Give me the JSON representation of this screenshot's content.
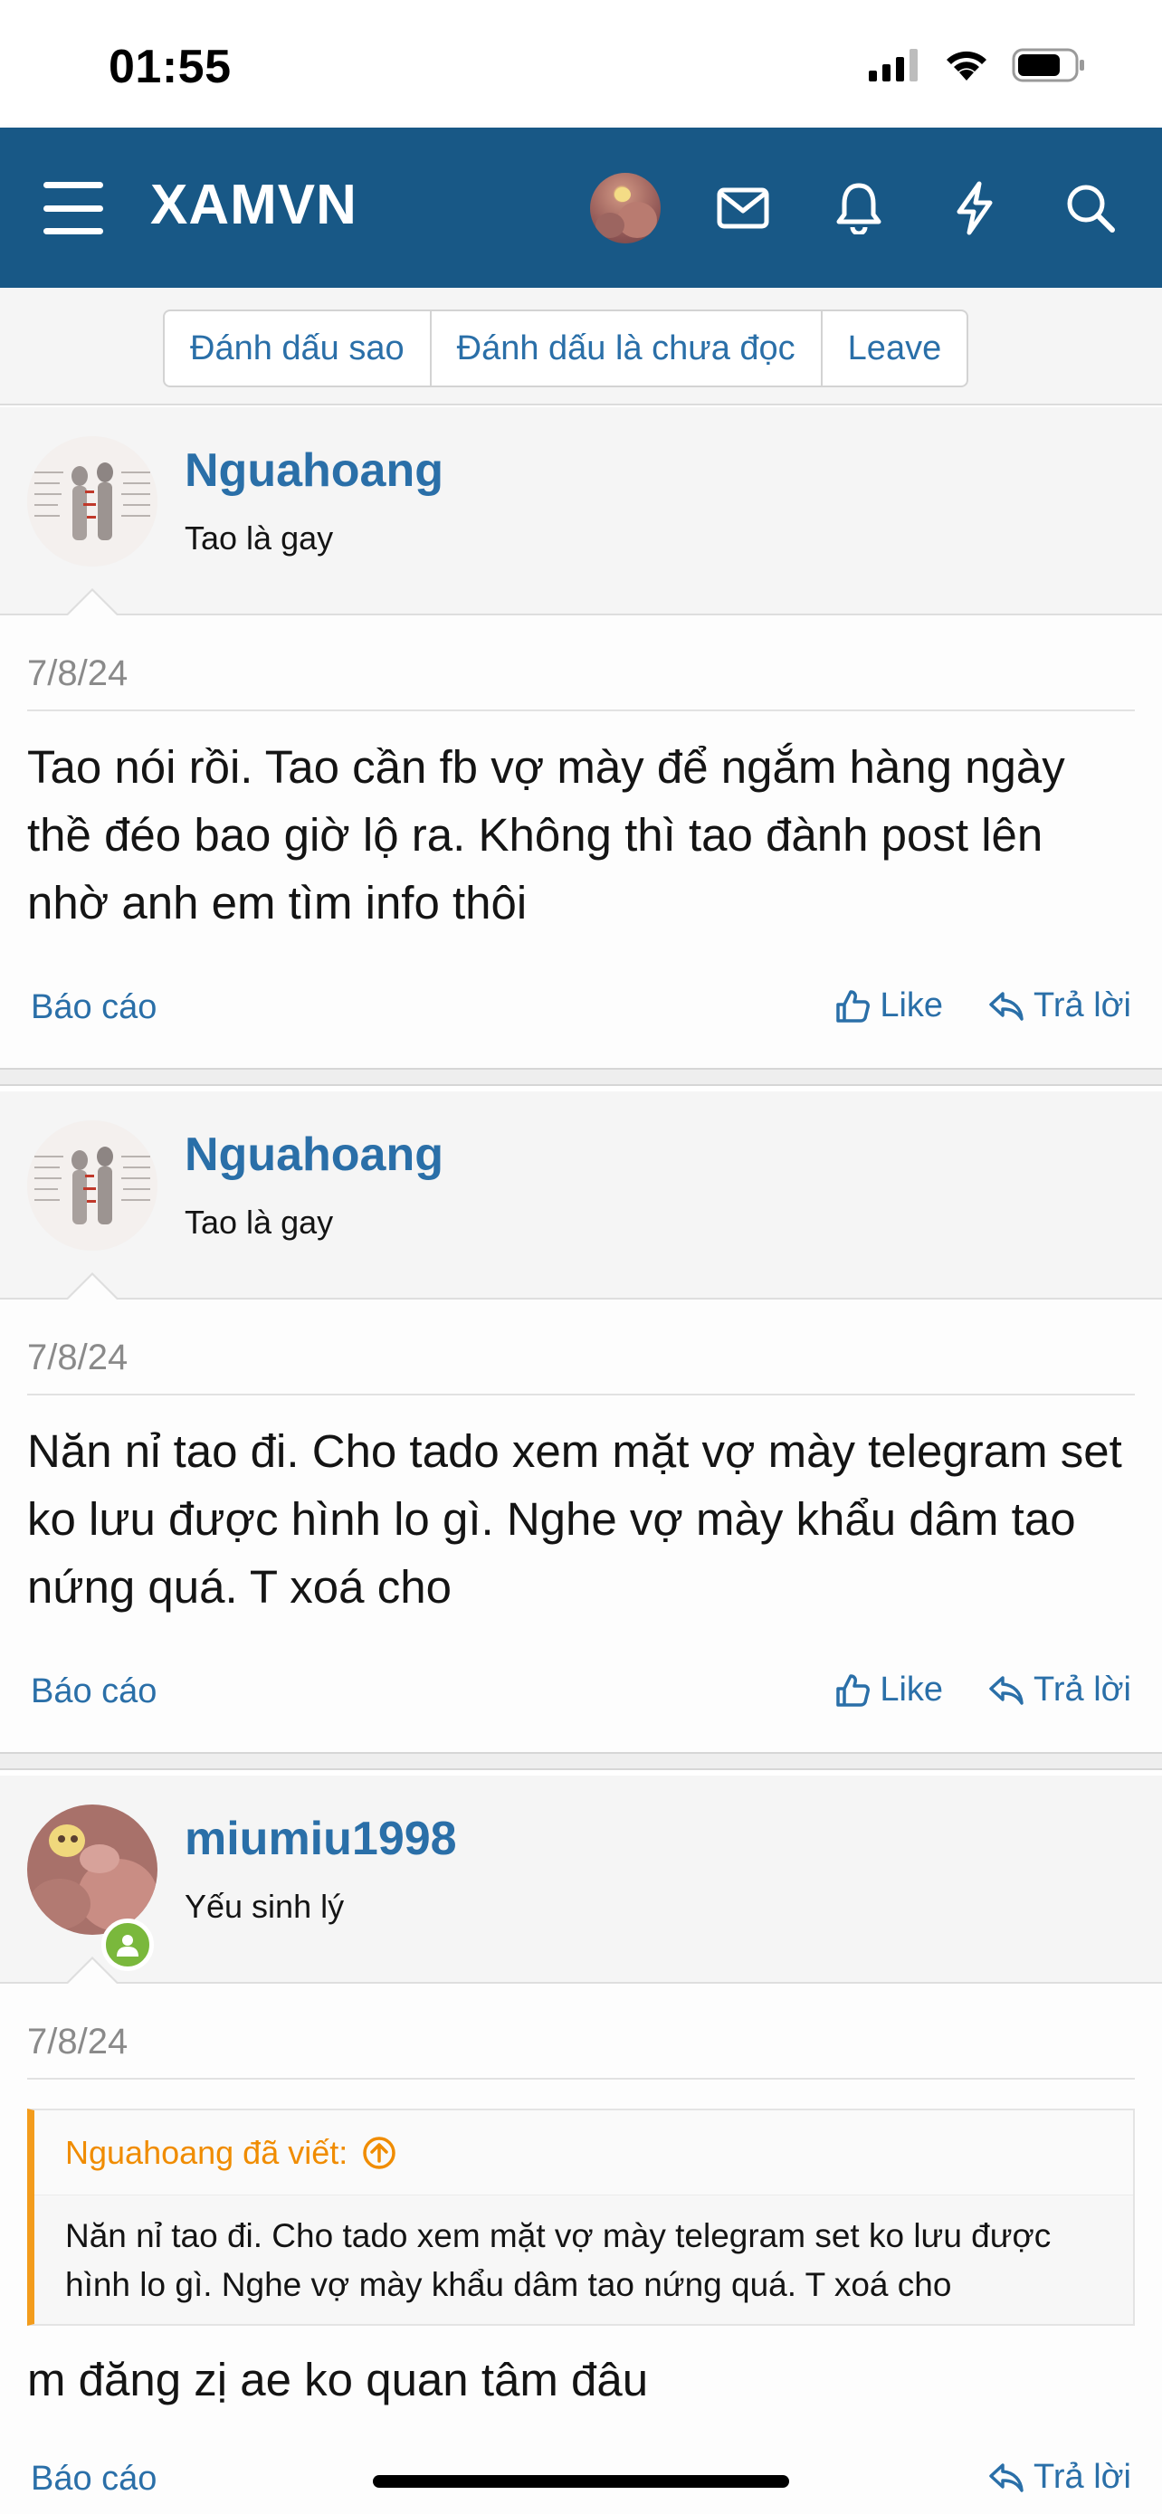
{
  "status_bar": {
    "time": "01:55"
  },
  "header": {
    "logo": "XAMVN",
    "icons": [
      "menu-icon",
      "avatar",
      "envelope-icon",
      "bell-icon",
      "bolt-icon",
      "search-icon"
    ]
  },
  "thread_actions": [
    "Đánh dấu sao",
    "Đánh dấu là chưa đọc",
    "Leave"
  ],
  "posts": [
    {
      "username": "Nguahoang",
      "user_title": "Tao là gay",
      "date": "7/8/24",
      "body": "Tao nói rồi. Tao cần fb vợ mày để ngắm hàng ngày thề đéo bao giờ lộ ra. Không thì tao đành post lên nhờ anh em tìm info thôi",
      "report": "Báo cáo",
      "like": "Like",
      "reply": "Trả lời"
    },
    {
      "username": "Nguahoang",
      "user_title": "Tao là gay",
      "date": "7/8/24",
      "body": "Năn nỉ tao đi. Cho tado xem mặt vợ mày telegram set ko lưu được hình lo gì. Nghe vợ mày khẩu dâm tao nứng quá. T xoá cho",
      "report": "Báo cáo",
      "like": "Like",
      "reply": "Trả lời"
    },
    {
      "username": "miumiu1998",
      "user_title": "Yếu sinh lý",
      "date": "7/8/24",
      "quote_author": "Nguahoang đã viết:",
      "quote_text": "Năn nỉ tao đi. Cho tado xem mặt vợ mày telegram set ko lưu được hình lo gì. Nghe vợ mày khẩu dâm tao nứng quá. T xoá cho",
      "body": "m đăng zị ae ko quan tâm đâu",
      "report": "Báo cáo",
      "reply": "Trả lời"
    }
  ],
  "colors": {
    "header_bg": "#185886",
    "link": "#2a6fa8",
    "quote_accent": "#f39c1c",
    "online": "#7ab83c"
  }
}
